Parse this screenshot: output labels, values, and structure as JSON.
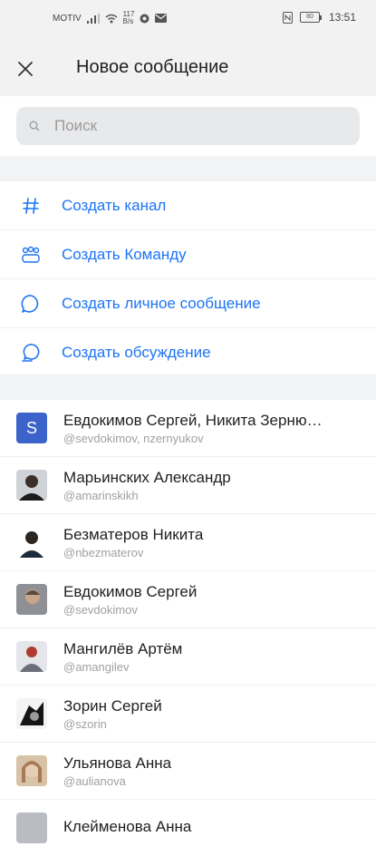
{
  "status_bar": {
    "carrier": "MOTIV",
    "speed_value": "117",
    "speed_unit": "B/s",
    "battery": "80",
    "time": "13:51"
  },
  "header": {
    "title": "Новое сообщение"
  },
  "search": {
    "placeholder": "Поиск"
  },
  "actions": [
    {
      "label": "Создать канал",
      "icon": "hash-icon"
    },
    {
      "label": "Создать Команду",
      "icon": "team-icon"
    },
    {
      "label": "Создать личное сообщение",
      "icon": "chat-bubble-icon"
    },
    {
      "label": "Создать обсуждение",
      "icon": "discussion-icon"
    }
  ],
  "contacts": [
    {
      "name": "Евдокимов Сергей, Никита Зерню…",
      "username": "@sevdokimov, nzernyukov",
      "avatar_letter": "S"
    },
    {
      "name": "Марьинских Александр",
      "username": "@amarinskikh"
    },
    {
      "name": "Безматеров Никита",
      "username": "@nbezmaterov"
    },
    {
      "name": "Евдокимов Сергей",
      "username": "@sevdokimov"
    },
    {
      "name": "Мангилёв Артём",
      "username": "@amangilev"
    },
    {
      "name": "Зорин Сергей",
      "username": "@szorin"
    },
    {
      "name": "Ульянова Анна",
      "username": "@aulianova"
    },
    {
      "name": "Клейменова Анна",
      "username": ""
    }
  ],
  "colors": {
    "accent": "#1d74f5",
    "header_bg": "#f2f2f2",
    "separator_bg": "#f2f3f5"
  }
}
